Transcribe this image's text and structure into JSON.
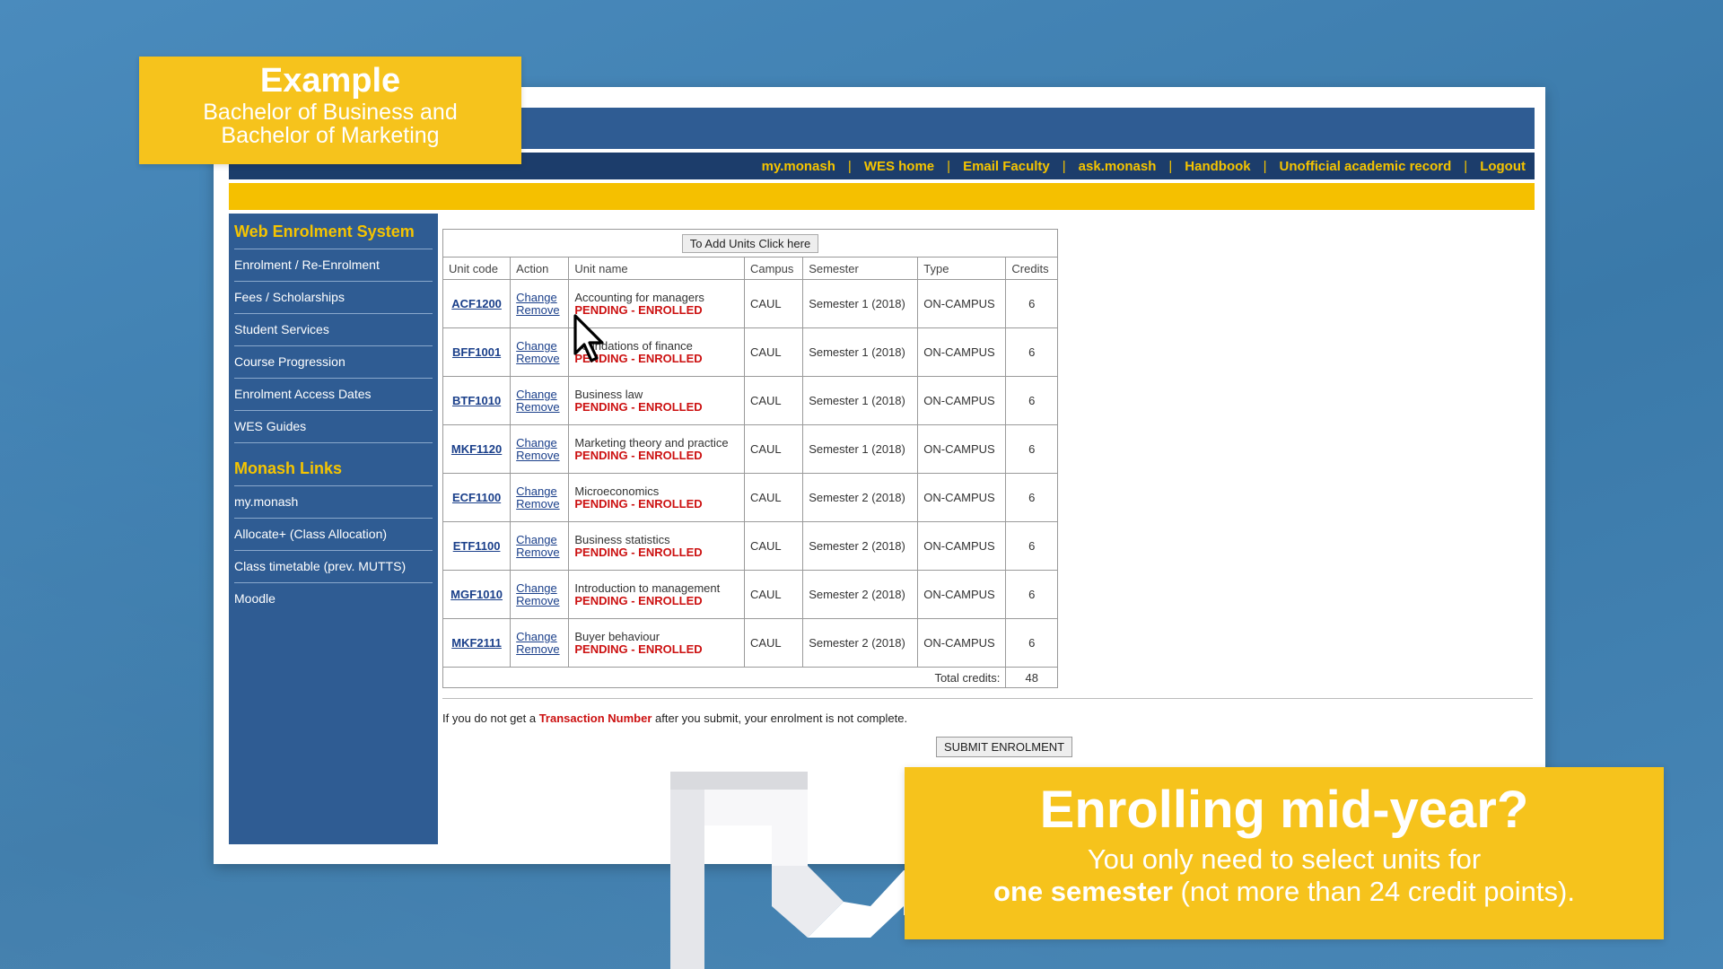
{
  "example": {
    "title": "Example",
    "line1": "Bachelor of Business and",
    "line2": "Bachelor of Marketing"
  },
  "nav": {
    "links": [
      "my.monash",
      "WES home",
      "Email Faculty",
      "ask.monash",
      "Handbook",
      "Unofficial academic record",
      "Logout"
    ],
    "separator": "|"
  },
  "sidebar": {
    "heading1": "Web Enrolment System",
    "items1": [
      "Enrolment / Re-Enrolment",
      "Fees / Scholarships",
      "Student Services",
      "Course Progression",
      "Enrolment Access Dates",
      "WES Guides"
    ],
    "heading2": "Monash Links",
    "items2": [
      "my.monash",
      "Allocate+ (Class Allocation)",
      "Class timetable (prev. MUTTS)",
      "Moodle"
    ]
  },
  "table": {
    "add_button": "To Add Units Click here",
    "headers": [
      "Unit code",
      "Action",
      "Unit name",
      "Campus",
      "Semester",
      "Type",
      "Credits"
    ],
    "change_label": "Change",
    "remove_label": "Remove",
    "rows": [
      {
        "code": "ACF1200",
        "name": "Accounting for managers",
        "status": "PENDING - ENROLLED",
        "campus": "CAUL",
        "semester": "Semester 1 (2018)",
        "type": "ON-CAMPUS",
        "credits": "6"
      },
      {
        "code": "BFF1001",
        "name": "Foundations of finance",
        "status": "PENDING - ENROLLED",
        "campus": "CAUL",
        "semester": "Semester 1 (2018)",
        "type": "ON-CAMPUS",
        "credits": "6"
      },
      {
        "code": "BTF1010",
        "name": "Business law",
        "status": "PENDING - ENROLLED",
        "campus": "CAUL",
        "semester": "Semester 1 (2018)",
        "type": "ON-CAMPUS",
        "credits": "6"
      },
      {
        "code": "MKF1120",
        "name": "Marketing theory and practice",
        "status": "PENDING - ENROLLED",
        "campus": "CAUL",
        "semester": "Semester 1 (2018)",
        "type": "ON-CAMPUS",
        "credits": "6"
      },
      {
        "code": "ECF1100",
        "name": "Microeconomics",
        "status": "PENDING - ENROLLED",
        "campus": "CAUL",
        "semester": "Semester 2 (2018)",
        "type": "ON-CAMPUS",
        "credits": "6"
      },
      {
        "code": "ETF1100",
        "name": "Business statistics",
        "status": "PENDING - ENROLLED",
        "campus": "CAUL",
        "semester": "Semester 2 (2018)",
        "type": "ON-CAMPUS",
        "credits": "6"
      },
      {
        "code": "MGF1010",
        "name": "Introduction to management",
        "status": "PENDING - ENROLLED",
        "campus": "CAUL",
        "semester": "Semester 2 (2018)",
        "type": "ON-CAMPUS",
        "credits": "6"
      },
      {
        "code": "MKF2111",
        "name": "Buyer behaviour",
        "status": "PENDING - ENROLLED",
        "campus": "CAUL",
        "semester": "Semester 2 (2018)",
        "type": "ON-CAMPUS",
        "credits": "6"
      }
    ],
    "total_label": "Total credits:",
    "total_value": "48"
  },
  "notice": {
    "before": "If you do not get a ",
    "highlight": "Transaction Number",
    "after": " after you submit, your enrolment is not complete."
  },
  "submit_button": "SUBMIT ENROLMENT",
  "midyear": {
    "title": "Enrolling mid-year?",
    "line1": "You only need to select units for",
    "line2_bold": "one semester",
    "line2_rest": " (not more than 24 credit points)."
  }
}
